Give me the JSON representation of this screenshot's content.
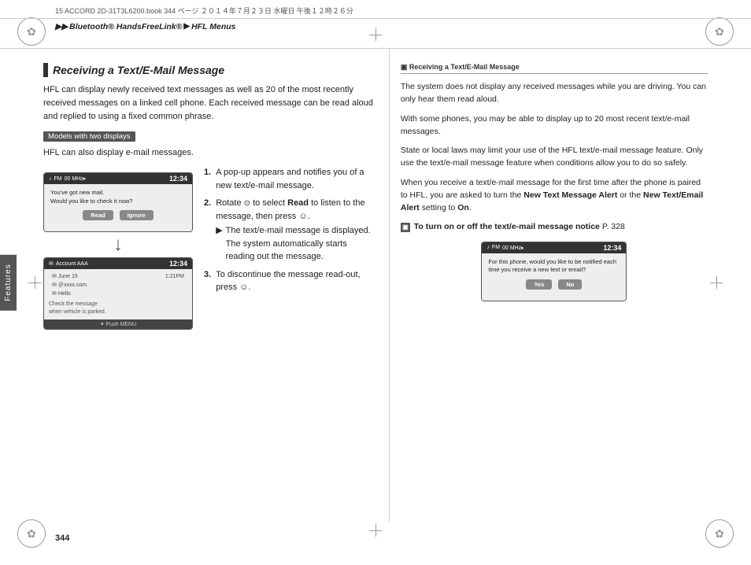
{
  "page": {
    "number": "344",
    "print_line": "15 ACCORD 2D-31T3L6200.book  344 ページ  ２０１４年７月２３日  水曜日  午後１２時２６分",
    "breadcrumb": {
      "prefix": "▶▶",
      "parts": [
        "Bluetooth® HandsFreeLink®",
        "HFL Menus"
      ]
    }
  },
  "side_tab": {
    "label": "Features"
  },
  "left": {
    "section_title": "Receiving a Text/E-Mail Message",
    "intro": "HFL can display newly received text messages as well as 20 of the most recently received messages on a linked cell phone. Each received message can be read aloud and replied to using a fixed common phrase.",
    "models_badge": "Models with two displays",
    "models_text": "HFL can also display e-mail messages.",
    "steps": [
      {
        "num": "1.",
        "text": "A pop-up appears and notifies you of a new text/e-mail message."
      },
      {
        "num": "2.",
        "text": "Rotate",
        "rotate_icon": "⊙",
        "text2": "to select",
        "bold": "Read",
        "text3": "to listen to the message, then press",
        "press_icon": "☺",
        "text4": ".",
        "sub": "The text/e-mail message is displayed. The system automatically starts reading out the message."
      },
      {
        "num": "3.",
        "text": "To discontinue the message read-out, press",
        "press_icon": "☺",
        "text2": "."
      }
    ],
    "screen1": {
      "header_left": "♪  FM",
      "header_signal": "00 MHz▸",
      "header_time": "12:34",
      "message": "You've got new mail.\nWould you like to check it now?",
      "sub_text": "",
      "btn1": "Read",
      "btn2": "Ignore"
    },
    "screen2": {
      "header_left": "✉  Account AAA",
      "header_time": "12:34",
      "rows": [
        {
          "icon": "✉",
          "label": "June 15",
          "time": "1:21PM"
        },
        {
          "icon": "✉",
          "label": "＠xxxx.com",
          "time": ""
        },
        {
          "icon": "✉",
          "label": "Hello",
          "time": ""
        }
      ],
      "note": "Check the message\nwhen vehicle is parked.",
      "footer": "✦ Push MENU"
    }
  },
  "right": {
    "section_title": "Receiving a Text/E-Mail Message",
    "paragraphs": [
      "The system does not display any received messages while you are driving. You can only hear them read aloud.",
      "With some phones, you may be able to display up to 20 most recent text/e-mail messages.",
      "State or local laws may limit your use of the HFL text/e-mail message feature. Only use the text/e-mail message feature when conditions allow you to do so safely.",
      "When you receive a text/e-mail message for the first time after the phone is paired to HFL, you are asked to turn the New Text Message Alert or the New Text/Email Alert setting to On."
    ],
    "note_link": "To turn on or off the text/e-mail message notice P. 328",
    "screen": {
      "header_left": "♪  FM",
      "header_signal": "00 MHz▸",
      "header_time": "12:34",
      "message": "For this phone, would you like to be notified each time you receive a new text or email?",
      "btn1": "Yes",
      "btn2": "No"
    }
  }
}
